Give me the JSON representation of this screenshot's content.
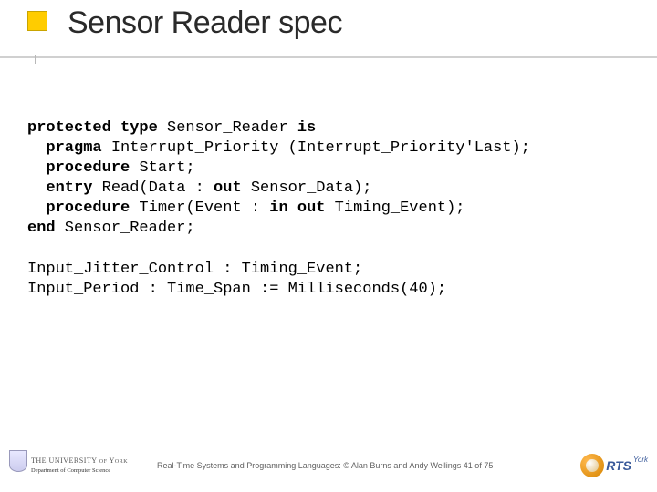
{
  "title": "Sensor Reader spec",
  "code": {
    "l1a": "protected type",
    "l1b": " Sensor_Reader ",
    "l1c": "is",
    "l2a": "  ",
    "l2b": "pragma",
    "l2c": " Interrupt_Priority (Interrupt_Priority'Last);",
    "l3a": "  ",
    "l3b": "procedure",
    "l3c": " Start;",
    "l4a": "  ",
    "l4b": "entry",
    "l4c": " Read(Data : ",
    "l4d": "out",
    "l4e": " Sensor_Data);",
    "l5a": "  ",
    "l5b": "procedure",
    "l5c": " Timer(Event : ",
    "l5d": "in out",
    "l5e": " Timing_Event);",
    "l6a": "end",
    "l6b": " Sensor_Reader;",
    "blank": "",
    "l8": "Input_Jitter_Control : Timing_Event;",
    "l9": "Input_Period : Time_Span := Milliseconds(40);"
  },
  "footer": {
    "uni_name": "THE UNIVERSITY of York",
    "dept": "Department of Computer Science",
    "text": "Real-Time Systems and Programming Languages: © Alan Burns and Andy Wellings  41 of 75",
    "rts": "RTS",
    "york": "York"
  }
}
